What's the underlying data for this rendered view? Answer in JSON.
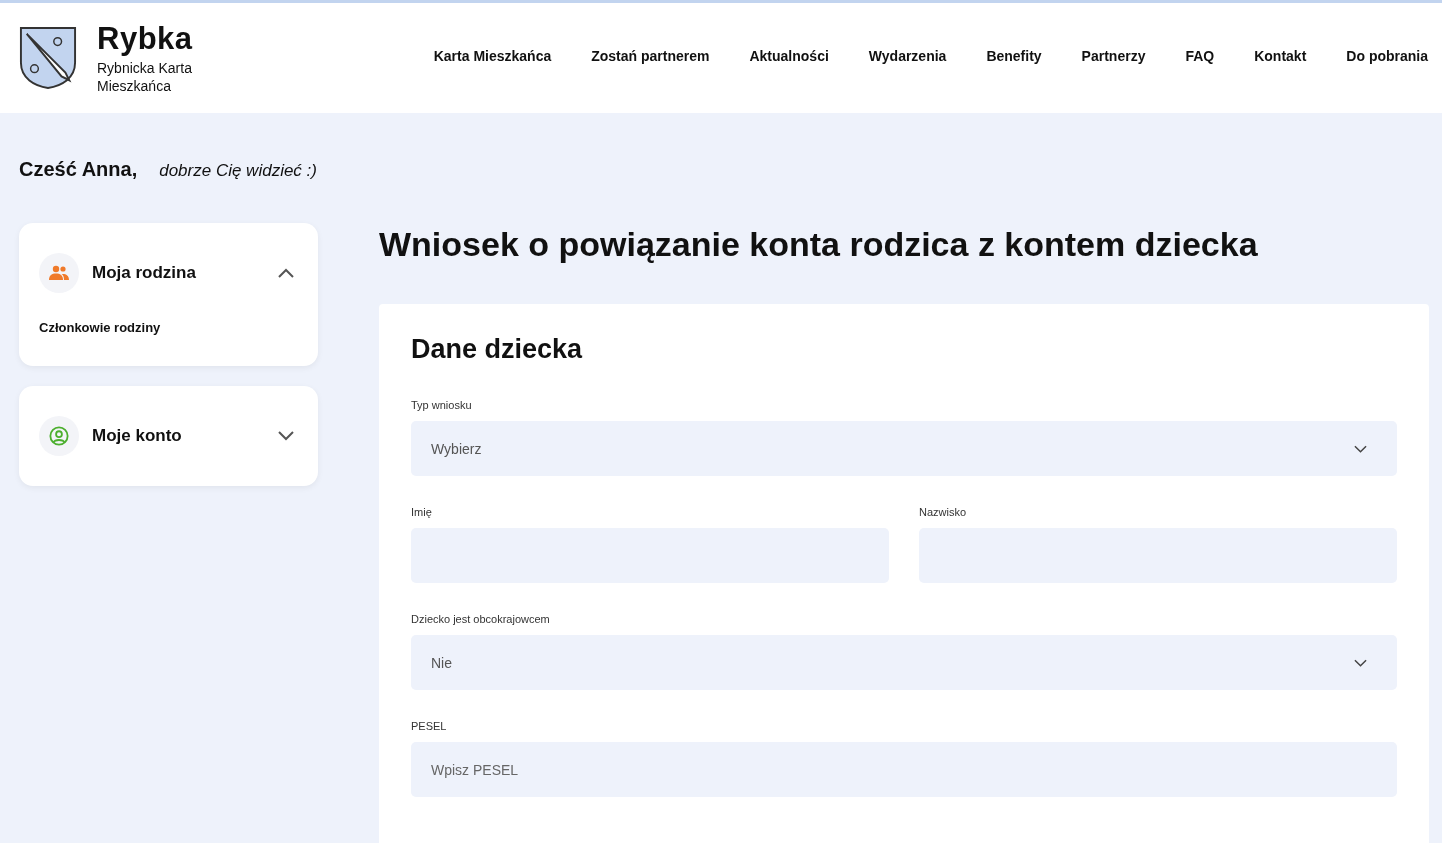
{
  "logo": {
    "title": "Rybka",
    "subtitle": "Rybnicka Karta Mieszkańca"
  },
  "nav": [
    "Karta Mieszkańca",
    "Zostań partnerem",
    "Aktualności",
    "Wydarzenia",
    "Benefity",
    "Partnerzy",
    "FAQ",
    "Kontakt",
    "Do pobrania"
  ],
  "greeting": {
    "name": "Cześć Anna,",
    "message": "dobrze Cię widzieć :)"
  },
  "sidebar": [
    {
      "title": "Moja rodzina",
      "kind": "family",
      "color": "#f07a2a",
      "expanded": true,
      "items": [
        "Członkowie rodziny"
      ]
    },
    {
      "title": "Moje konto",
      "kind": "account",
      "color": "#4caf2e",
      "expanded": false
    }
  ],
  "page_title": "Wniosek o powiązanie konta rodzica z kontem dziecka",
  "form": {
    "section_title": "Dane dziecka",
    "rows": [
      [
        {
          "label": "Typ wniosku",
          "kind": "select",
          "value": "Wybierz"
        }
      ],
      [
        {
          "label": "Imię",
          "kind": "input"
        },
        {
          "label": "Nazwisko",
          "kind": "input"
        }
      ],
      [
        {
          "label": "Dziecko jest obcokrajowcem",
          "kind": "select",
          "value": "Nie"
        }
      ],
      [
        {
          "label": "PESEL",
          "kind": "input",
          "placeholder": "Wpisz PESEL"
        }
      ]
    ]
  }
}
